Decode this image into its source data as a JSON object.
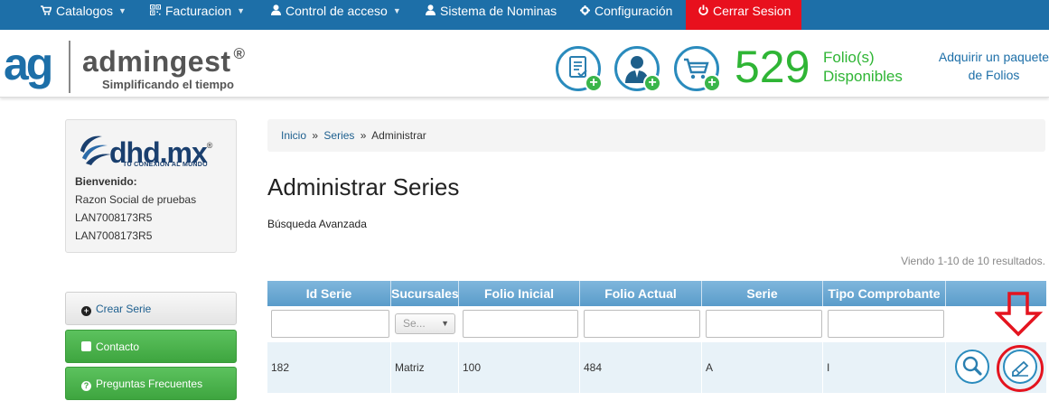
{
  "nav": {
    "items": [
      {
        "label": "Catalogos",
        "icon": "cart-icon",
        "caret": true
      },
      {
        "label": "Facturacion",
        "icon": "qr-icon",
        "caret": true
      },
      {
        "label": "Control de acceso",
        "icon": "user-icon",
        "caret": true
      },
      {
        "label": "Sistema de Nominas",
        "icon": "user-icon",
        "caret": false
      },
      {
        "label": "Configuración",
        "icon": "gear-icon",
        "caret": false
      }
    ],
    "logout": {
      "label": "Cerrar Sesion",
      "icon": "power-icon",
      "color": "#e8101d"
    },
    "bg_color": "#1d6fa8"
  },
  "header": {
    "logo_mark": "ag",
    "logo_name": "admingest",
    "logo_registered": "®",
    "tagline": "Simplificando el tiempo",
    "actions": [
      {
        "name": "new-invoice",
        "icon": "document-check-icon"
      },
      {
        "name": "new-user",
        "icon": "user-icon"
      },
      {
        "name": "buy-folios",
        "icon": "cart-icon"
      }
    ],
    "folio_count": "529",
    "folio_label_1": "Folio(s)",
    "folio_label_2": "Disponibles",
    "buy_link_1": "Adquirir un paquete",
    "buy_link_2": "de Folios",
    "accent_green": "#2fb535"
  },
  "profile": {
    "company_logo": "dhd.mx",
    "company_registered": "®",
    "company_tagline": "TU CONEXIÓN AL MUNDO",
    "welcome": "Bienvenido:",
    "razon_social": "Razon Social de pruebas",
    "rfc_1": "LAN7008173R5",
    "rfc_2": "LAN7008173R5"
  },
  "sidebar": {
    "crear_serie": "Crear Serie",
    "contacto": "Contacto",
    "preguntas": "Preguntas Frecuentes"
  },
  "breadcrumb": {
    "items": [
      "Inicio",
      "Series",
      "Administrar"
    ],
    "separator": "»"
  },
  "page": {
    "title": "Administrar Series",
    "advanced_search": "Búsqueda Avanzada",
    "results_summary": "Viendo 1-10 de 10 resultados."
  },
  "table": {
    "columns": [
      "Id Serie",
      "Sucursales",
      "Folio Inicial",
      "Folio Actual",
      "Serie",
      "Tipo Comprobante",
      ""
    ],
    "filter_select_placeholder": "Se...",
    "rows": [
      {
        "id_serie": "182",
        "sucursal": "Matriz",
        "folio_inicial": "100",
        "folio_actual": "484",
        "serie": "A",
        "tipo_comprobante": "I"
      }
    ],
    "row_actions": [
      {
        "name": "view",
        "icon": "magnifier-icon"
      },
      {
        "name": "edit",
        "icon": "pencil-icon"
      }
    ],
    "highlight_color": "#e4141f"
  }
}
